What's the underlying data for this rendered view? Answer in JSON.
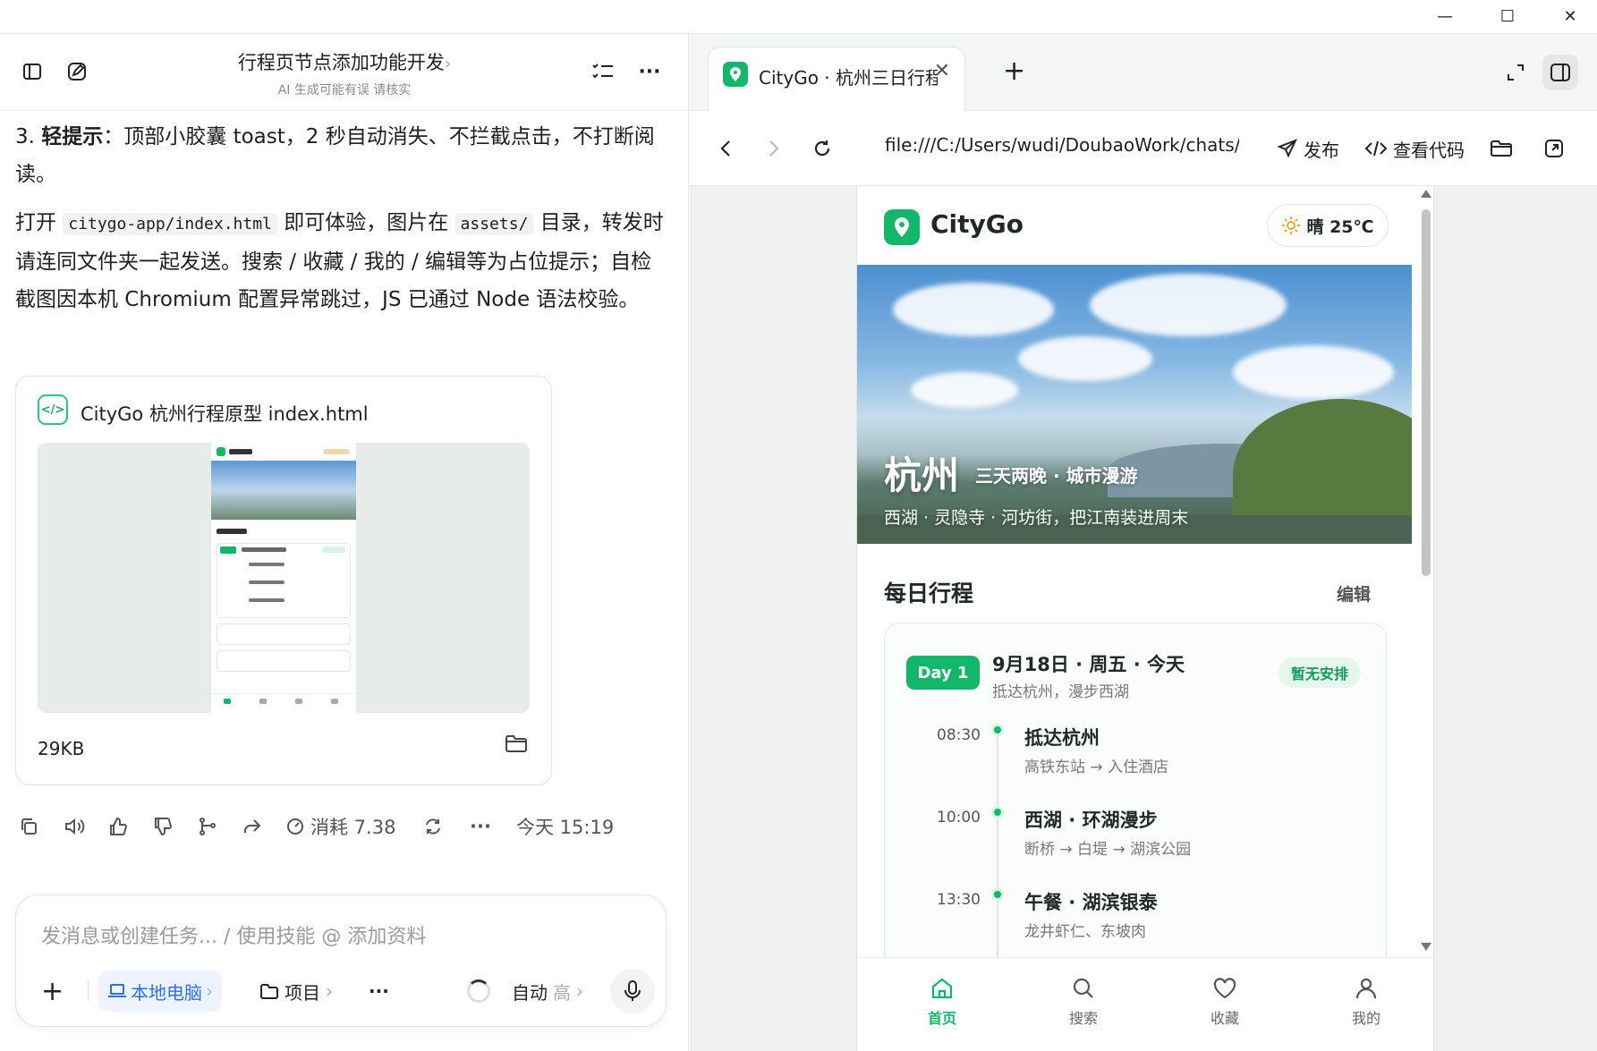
{
  "window": {
    "minimize": "—",
    "maximize": "☐",
    "close": "✕"
  },
  "chat": {
    "title": "行程页节点添加功能开发",
    "title_chevron": "›",
    "subtitle": "AI 生成可能有误 请核实",
    "tip_index": "3.",
    "tip_bold": "轻提示",
    "tip_text": "：顶部小胶囊 toast，2 秒自动消失、不拦截点击，不打断阅读。",
    "p_open": "打开",
    "p_code1": "citygo-app/index.html",
    "p_mid1": "即可体验，图片在",
    "p_code2": "assets/",
    "p_rest": "目录，转发时请连同文件夹一起发送。搜索 / 收藏 / 我的 / 编辑等为占位提示；自检截图因本机 Chromium 配置异常跳过，JS 已通过 Node 语法校验。",
    "file": {
      "name": "CityGo 杭州行程原型 index.html",
      "size": "29KB"
    },
    "actions": {
      "cost": "消耗 7.38",
      "time": "今天 15:19"
    },
    "composer": {
      "placeholder": "发消息或创建任务... / 使用技能 @ 添加资料",
      "local": "本地电脑",
      "project": "项目",
      "more": "···",
      "auto": "自动",
      "level": "高"
    }
  },
  "browser": {
    "tab_title": "CityGo · 杭州三日行程",
    "url": "file:///C:/Users/wudi/DoubaoWork/chats/2",
    "publish": "发布",
    "view_code": "查看代码"
  },
  "app": {
    "brand": "CityGo",
    "weather": "晴 25℃",
    "hero": {
      "city": "杭州",
      "tag": "三天两晚 · 城市漫游",
      "desc": "西湖 · 灵隐寺 · 河坊街，把江南装进周末"
    },
    "section_title": "每日行程",
    "edit": "编辑",
    "day": {
      "pill": "Day 1",
      "date": "9月18日 · 周五 · 今天",
      "sub": "抵达杭州，漫步西湖",
      "status": "暂无安排",
      "items": [
        {
          "time": "08:30",
          "title": "抵达杭州",
          "desc": "高铁东站 → 入住酒店"
        },
        {
          "time": "10:00",
          "title": "西湖 · 环湖漫步",
          "desc": "断桥 → 白堤 → 湖滨公园"
        },
        {
          "time": "13:30",
          "title": "午餐 · 湖滨银泰",
          "desc": "龙井虾仁、东坡肉"
        }
      ]
    },
    "nav": [
      {
        "label": "首页"
      },
      {
        "label": "搜索"
      },
      {
        "label": "收藏"
      },
      {
        "label": "我的"
      }
    ]
  },
  "colors": {
    "accent": "#12b76a",
    "link_blue": "#2f6fe4"
  }
}
